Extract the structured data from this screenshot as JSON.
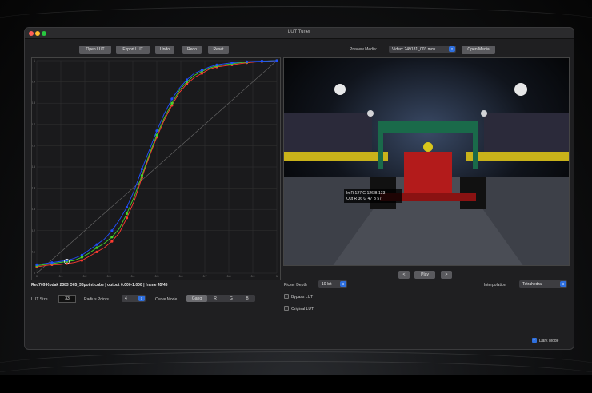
{
  "window": {
    "title": "LUT Tuner"
  },
  "toolbar": {
    "open_lut": "Open LUT",
    "export_lut": "Export LUT",
    "undo": "Undo",
    "redo": "Redo",
    "reset": "Reset",
    "preview_media_label": "Preview Media:",
    "preview_media_value": "Video: 249181_003.mov",
    "open_media": "Open Media"
  },
  "chart_data": {
    "type": "line",
    "x_ticks": [
      "0",
      "0.1",
      "0.2",
      "0.3",
      "0.4",
      "0.5",
      "0.6",
      "0.7",
      "0.8",
      "0.9",
      "1"
    ],
    "y_ticks": [
      "0",
      "0.1",
      "0.2",
      "0.3",
      "0.4",
      "0.5",
      "0.6",
      "0.7",
      "0.8",
      "0.9",
      "1"
    ],
    "xlim": [
      0,
      1
    ],
    "ylim": [
      0,
      1
    ],
    "grid": true,
    "x": [
      0,
      0.031,
      0.063,
      0.094,
      0.125,
      0.156,
      0.188,
      0.219,
      0.25,
      0.281,
      0.313,
      0.344,
      0.375,
      0.406,
      0.438,
      0.469,
      0.5,
      0.531,
      0.563,
      0.594,
      0.625,
      0.656,
      0.688,
      0.719,
      0.75,
      0.781,
      0.813,
      0.844,
      0.875,
      0.906,
      0.938,
      0.969,
      1
    ],
    "series": [
      {
        "color": "#ff3b30",
        "values": [
          0.03,
          0.035,
          0.04,
          0.04,
          0.045,
          0.05,
          0.06,
          0.08,
          0.1,
          0.12,
          0.15,
          0.19,
          0.26,
          0.34,
          0.45,
          0.55,
          0.64,
          0.72,
          0.79,
          0.85,
          0.89,
          0.92,
          0.94,
          0.96,
          0.97,
          0.975,
          0.98,
          0.985,
          0.99,
          0.993,
          0.996,
          0.998,
          1.0
        ]
      },
      {
        "color": "#44d62c",
        "values": [
          0.035,
          0.04,
          0.045,
          0.05,
          0.055,
          0.06,
          0.075,
          0.095,
          0.12,
          0.14,
          0.17,
          0.21,
          0.28,
          0.36,
          0.46,
          0.56,
          0.65,
          0.73,
          0.8,
          0.86,
          0.9,
          0.93,
          0.95,
          0.965,
          0.975,
          0.98,
          0.985,
          0.99,
          0.993,
          0.995,
          0.997,
          0.999,
          1.0
        ]
      },
      {
        "color": "#2050ff",
        "values": [
          0.04,
          0.045,
          0.05,
          0.055,
          0.06,
          0.07,
          0.085,
          0.11,
          0.135,
          0.16,
          0.2,
          0.25,
          0.31,
          0.39,
          0.49,
          0.58,
          0.67,
          0.75,
          0.82,
          0.87,
          0.91,
          0.94,
          0.955,
          0.97,
          0.98,
          0.985,
          0.99,
          0.993,
          0.995,
          0.997,
          0.998,
          0.999,
          1.0
        ]
      }
    ]
  },
  "status": {
    "info": "Rec709 Kodak 2383 D65_33point.cube | output 0.000-1.000 | frame 45/45"
  },
  "controls": {
    "lut_size_label": "LUT Size",
    "lut_size_value": "33",
    "radius_label": "Radius Points",
    "radius_value": "4",
    "curve_mode_label": "Curve Mode",
    "curve_modes": [
      "Gang",
      "R",
      "G",
      "B"
    ],
    "picker_depth_label": "Picker Depth",
    "picker_depth_value": "10-bit",
    "interpolation_label": "Interpolation",
    "interpolation_value": "Tetrahedral",
    "bypass_lut": "Bypass LUT",
    "original_lut": "Original LUT",
    "dark_mode": "Dark Mode"
  },
  "playback": {
    "prev": "<",
    "play": "Play",
    "next": ">"
  },
  "picker": {
    "in_line": "In R  127  G  126  B  133",
    "out_line": "Out R  36  G  47  B  57"
  }
}
